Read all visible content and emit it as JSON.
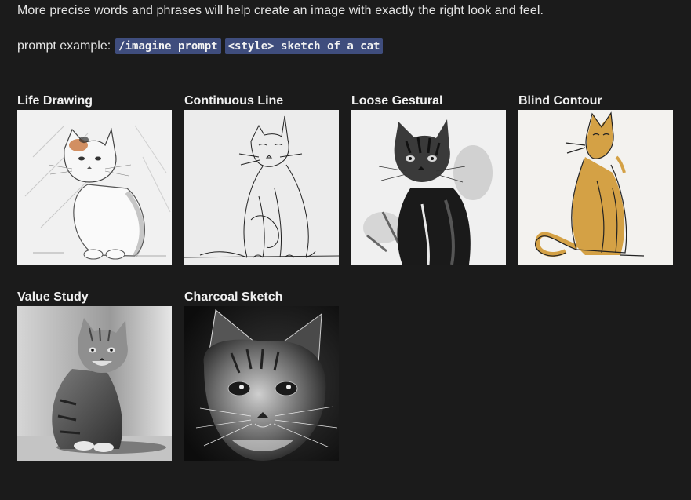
{
  "intro_text": "More precise words and phrases will help create an image with exactly the right look and feel.",
  "prompt_example": {
    "label": "prompt example:",
    "command": "/imagine prompt",
    "template": "<style> sketch of a cat"
  },
  "styles": [
    {
      "title": "Life Drawing",
      "image": "cat-life-drawing"
    },
    {
      "title": "Continuous Line",
      "image": "cat-continuous-line"
    },
    {
      "title": "Loose Gestural",
      "image": "cat-loose-gestural"
    },
    {
      "title": "Blind Contour",
      "image": "cat-blind-contour"
    },
    {
      "title": "Value Study",
      "image": "cat-value-study"
    },
    {
      "title": "Charcoal Sketch",
      "image": "cat-charcoal-sketch"
    }
  ],
  "colors": {
    "background": "#1b1b1b",
    "code_highlight": "#3f4d7d",
    "accent_ochre": "#d4a145"
  }
}
